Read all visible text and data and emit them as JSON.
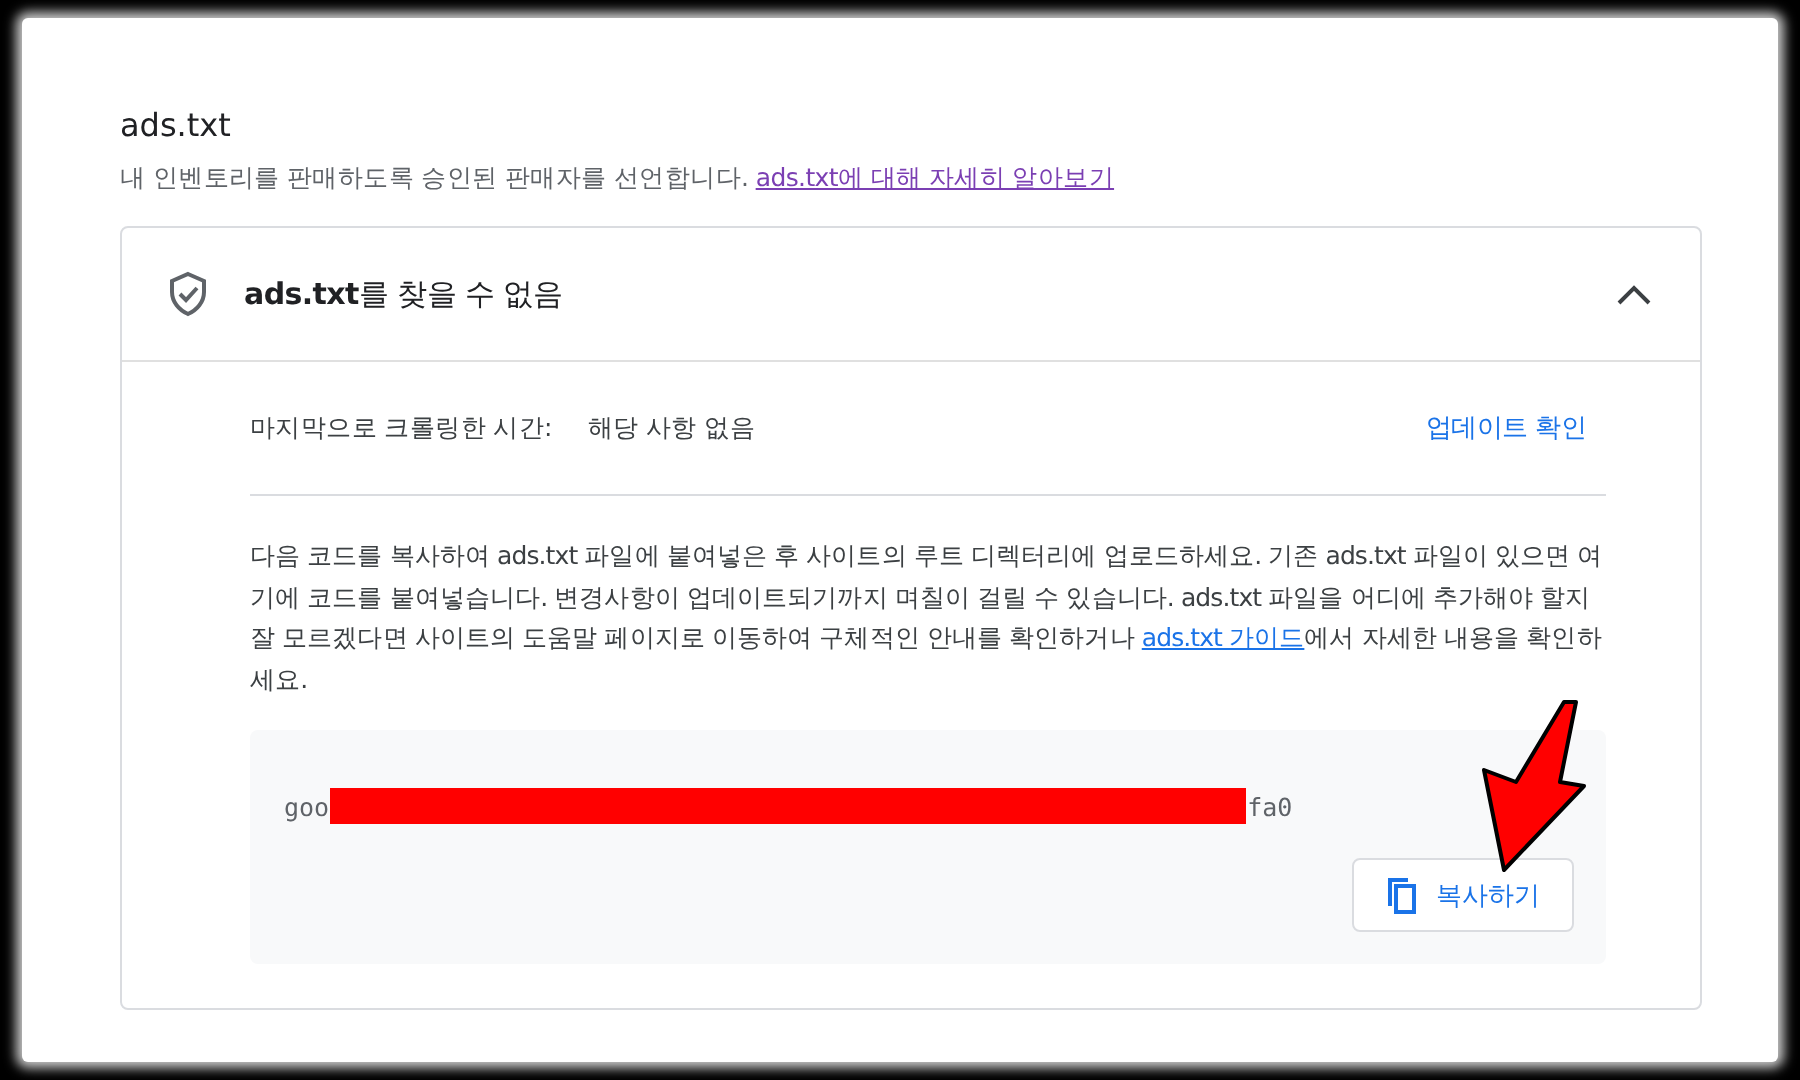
{
  "section": {
    "title": "ads.txt",
    "description": "내 인벤토리를 판매하도록 승인된 판매자를 선언합니다. ",
    "learn_more_link": "ads.txt에 대해 자세히 알아보기"
  },
  "panel": {
    "title": "**ads.txt**를 찾을 수 없음",
    "expanded": true,
    "crawl": {
      "label": "마지막으로 크롤링한 시간:",
      "value": "해당 사항 없음",
      "action": "업데이트 확인"
    },
    "instructions": {
      "text": "다음 코드를 복사하여 ads.txt 파일에 붙여넣은 후 사이트의 루트 디렉터리에 업로드하세요. 기존 ads.txt 파일이 있으면 여기에 코드를 붙여넣습니다. 변경사항이 업데이트되기까지 며칠이 걸릴 수 있습니다. ads.txt 파일을 어디에 추가해야 할지 잘 모르겠다면 사이트의 도움말 페이지로 이동하여 구체적인 안내를 확인하거나 ",
      "guide_link": "ads.txt 가이드",
      "tail": "에서 자세한 내용을 확인하세요."
    },
    "code": {
      "visible_start": "goo",
      "visible_end": "fa0",
      "redacted": true
    },
    "copy_button": "복사하기"
  }
}
